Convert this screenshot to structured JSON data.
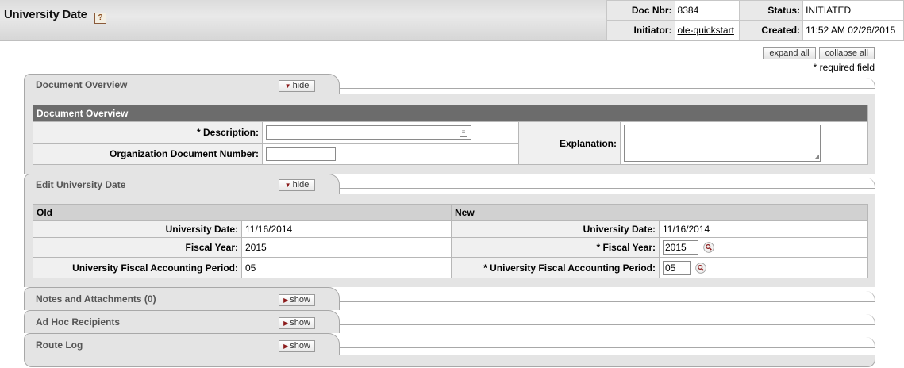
{
  "header": {
    "title": "University Date",
    "help_glyph": "?",
    "doc_nbr_label": "Doc Nbr:",
    "doc_nbr": "8384",
    "status_label": "Status:",
    "status": "INITIATED",
    "initiator_label": "Initiator:",
    "initiator": "ole-quickstart",
    "created_label": "Created:",
    "created": "11:52 AM 02/26/2015"
  },
  "controls": {
    "expand_all": "expand all",
    "collapse_all": "collapse all",
    "required_note": "* required field"
  },
  "tabs": {
    "document_overview": {
      "title": "Document Overview",
      "toggle": "hide"
    },
    "edit_university_date": {
      "title": "Edit University Date",
      "toggle": "hide"
    },
    "notes": {
      "title": "Notes and Attachments (0)",
      "toggle": "show"
    },
    "adhoc": {
      "title": "Ad Hoc Recipients",
      "toggle": "show"
    },
    "route_log": {
      "title": "Route Log",
      "toggle": "show"
    }
  },
  "overview": {
    "section_header": "Document Overview",
    "description_label": "* Description:",
    "description_value": "",
    "org_doc_number_label": "Organization Document Number:",
    "org_doc_number_value": "",
    "explanation_label": "Explanation:",
    "explanation_value": ""
  },
  "edit": {
    "old_header": "Old",
    "new_header": "New",
    "university_date_label": "University Date:",
    "fiscal_year_label": "Fiscal Year:",
    "period_label": "University Fiscal Accounting Period:",
    "req_fiscal_year_label": "* Fiscal Year:",
    "req_period_label": "* University Fiscal Accounting Period:",
    "old_university_date": "11/16/2014",
    "old_fiscal_year": "2015",
    "old_period": "05",
    "new_university_date": "11/16/2014",
    "new_fiscal_year": "2015",
    "new_period": "05"
  },
  "icons": {
    "lookup": "magnifier-icon",
    "help": "help-icon",
    "hide_arrow": "triangle-down-icon",
    "show_arrow": "triangle-right-icon"
  }
}
